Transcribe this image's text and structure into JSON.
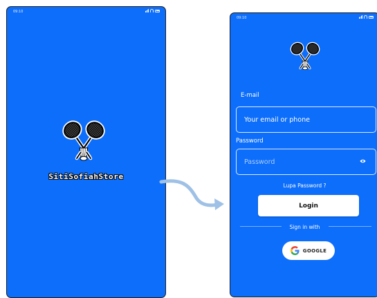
{
  "splash": {
    "status_time": "09:10",
    "brand_name": "SitiSofiahStore"
  },
  "login": {
    "status_time": "09:10",
    "email_label": "E-mail",
    "email_placeholder": "Your email or phone",
    "password_label": "Password",
    "password_placeholder": "Password",
    "forgot_password": "Lupa Password ?",
    "login_button": "Login",
    "sign_in_with": "Sign in with",
    "google_button": "GOOGLE"
  },
  "colors": {
    "background_blue": "#0d6efb",
    "arrow": "#9fc1e6"
  },
  "icons": [
    "badminton-logo-icon",
    "signal-icon",
    "wifi-icon",
    "battery-icon",
    "eye-icon",
    "google-icon",
    "flow-arrow-icon"
  ]
}
